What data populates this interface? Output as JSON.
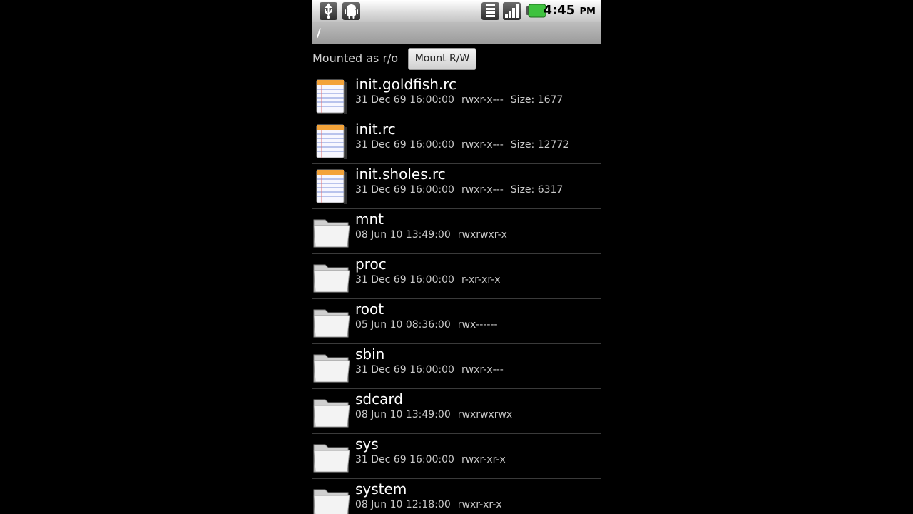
{
  "statusbar": {
    "left_icons": [
      "usb-icon",
      "android-debug-icon"
    ],
    "right_icons": [
      "wifi-icon",
      "signal-icon",
      "battery-icon"
    ],
    "time": "4:45",
    "ampm": "PM"
  },
  "path": "/",
  "mount": {
    "status": "Mounted as r/o",
    "button": "Mount R/W"
  },
  "files": [
    {
      "name": "init.goldfish.rc",
      "date": "31 Dec 69 16:00:00",
      "perms": "rwxr-x---",
      "size": "Size: 1677",
      "type": "file"
    },
    {
      "name": "init.rc",
      "date": "31 Dec 69 16:00:00",
      "perms": "rwxr-x---",
      "size": "Size: 12772",
      "type": "file"
    },
    {
      "name": "init.sholes.rc",
      "date": "31 Dec 69 16:00:00",
      "perms": "rwxr-x---",
      "size": "Size: 6317",
      "type": "file"
    },
    {
      "name": "mnt",
      "date": "08 Jun 10 13:49:00",
      "perms": "rwxrwxr-x",
      "size": "",
      "type": "folder"
    },
    {
      "name": "proc",
      "date": "31 Dec 69 16:00:00",
      "perms": "r-xr-xr-x",
      "size": "",
      "type": "folder"
    },
    {
      "name": "root",
      "date": "05 Jun 10 08:36:00",
      "perms": "rwx------",
      "size": "",
      "type": "folder"
    },
    {
      "name": "sbin",
      "date": "31 Dec 69 16:00:00",
      "perms": "rwxr-x---",
      "size": "",
      "type": "folder"
    },
    {
      "name": "sdcard",
      "date": "08 Jun 10 13:49:00",
      "perms": "rwxrwxrwx",
      "size": "",
      "type": "folder"
    },
    {
      "name": "sys",
      "date": "31 Dec 69 16:00:00",
      "perms": "rwxr-xr-x",
      "size": "",
      "type": "folder"
    },
    {
      "name": "system",
      "date": "08 Jun 10 12:18:00",
      "perms": "rwxr-xr-x",
      "size": "",
      "type": "folder"
    }
  ]
}
